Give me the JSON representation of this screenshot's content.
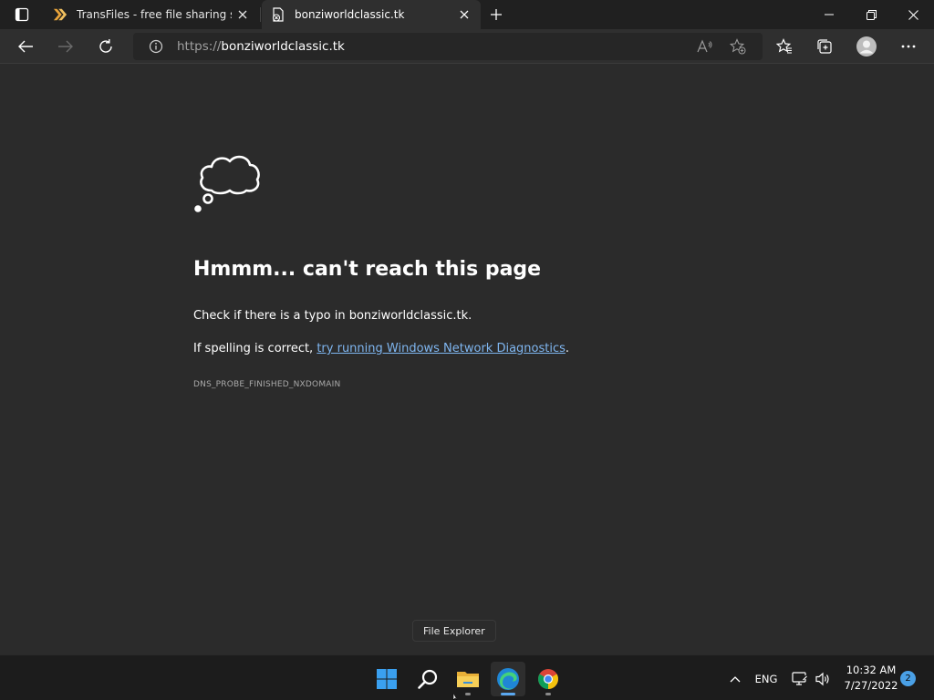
{
  "browser": {
    "tabs": [
      {
        "title": "TransFiles - free file sharing servi",
        "icon": "transfiles-chevron-icon",
        "active": false
      },
      {
        "title": "bonziworldclassic.tk",
        "icon": "page-error-icon",
        "active": true
      }
    ],
    "address": {
      "scheme": "https://",
      "host": "bonziworldclassic.tk"
    }
  },
  "error_page": {
    "title": "Hmmm... can't reach this page",
    "line1": "Check if there is a typo in bonziworldclassic.tk.",
    "line2_prefix": "If spelling is correct, ",
    "line2_link": "try running Windows Network Diagnostics",
    "line2_suffix": ".",
    "error_code": "DNS_PROBE_FINISHED_NXDOMAIN"
  },
  "tooltip": {
    "text": "File Explorer"
  },
  "taskbar": {
    "apps": [
      "start-icon",
      "search-icon",
      "file-explorer-icon",
      "edge-icon",
      "chrome-icon"
    ],
    "language": "ENG",
    "time": "10:32 AM",
    "date": "7/27/2022",
    "notifications": "2"
  },
  "colors": {
    "accent_link": "#7fb6f0",
    "page_bg": "#2b2b2b",
    "tab_strip_bg": "#202020"
  }
}
